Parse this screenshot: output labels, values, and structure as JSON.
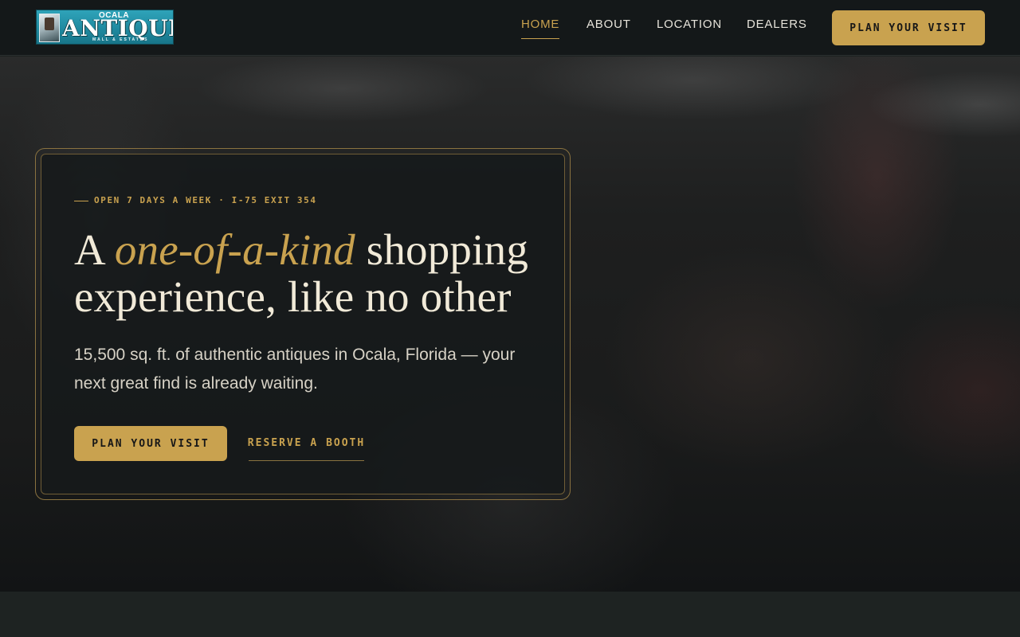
{
  "brand": {
    "logo_top": "OCALA",
    "logo_main": "ANTIQUE",
    "logo_sub": "MALL & ESTATES",
    "logo_icon": "storefront-photo"
  },
  "nav": {
    "items": [
      {
        "label": "HOME",
        "active": true
      },
      {
        "label": "ABOUT",
        "active": false
      },
      {
        "label": "LOCATION",
        "active": false
      },
      {
        "label": "DEALERS",
        "active": false
      }
    ],
    "cta_label": "PLAN YOUR VISIT"
  },
  "hero": {
    "eyebrow": "OPEN 7 DAYS A WEEK · I-75 EXIT 354",
    "headline_pre": "A ",
    "headline_em": "one-of-a-kind",
    "headline_mid": " shopping",
    "headline_line2": "experience, like no other",
    "lede": "15,500 sq. ft. of authentic antiques in Ocala, Florida — your next great find is already waiting.",
    "primary_cta": "PLAN YOUR VISIT",
    "secondary_cta": "RESERVE A BOOTH"
  },
  "colors": {
    "accent_gold": "#c9a24f",
    "header_bg": "#141819",
    "cream_text": "#f1ead8"
  }
}
